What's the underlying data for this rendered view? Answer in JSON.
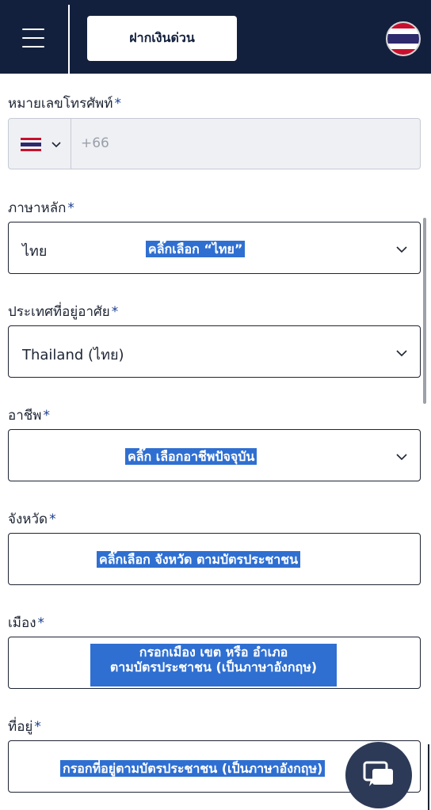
{
  "header": {
    "deposit_label": "ฝากเงินด่วน",
    "menu_icon": "hamburger-icon",
    "language_flag": "thailand-flag-icon"
  },
  "form": {
    "phone": {
      "label": "หมายเลขโทรศัพท์",
      "required_mark": "*",
      "country_code": "+66",
      "flag": "thailand-flag-icon"
    },
    "language": {
      "label": "ภาษาหลัก",
      "required_mark": "*",
      "value": "ไทย",
      "annotation": "คลิ๊กเลือก “ไทย”"
    },
    "country": {
      "label": "ประเทศที่อยู่อาศัย",
      "required_mark": "*",
      "value": "Thailand (ไทย)"
    },
    "occupation": {
      "label": "อาชีพ",
      "required_mark": "*",
      "annotation": "คลิ๊ก เลือกอาชีพปัจจุบัน"
    },
    "province": {
      "label": "จังหวัด",
      "required_mark": "*",
      "annotation": "คลิ๊กเลือก จังหวัด ตามบัตรประชาชน"
    },
    "city": {
      "label": "เมือง",
      "required_mark": "*",
      "annotation_line1": "กรอกเมือง เขต หรือ อำเภอ",
      "annotation_line2": "ตามบัตรประชาชน (เป็นภาษาอังกฤษ)"
    },
    "address": {
      "label": "ที่อยู่",
      "required_mark": "*",
      "annotation": "กรอกที่อยู่ตามบัตรประชาชน (เป็นภาษาอังกฤษ)"
    }
  },
  "chat": {
    "icon": "chat-bubble-icon"
  },
  "colors": {
    "header_bg": "#13203d",
    "accent": "#1b3d8f",
    "highlight": "#2f6fd1",
    "field_disabled": "#eef0f4"
  }
}
